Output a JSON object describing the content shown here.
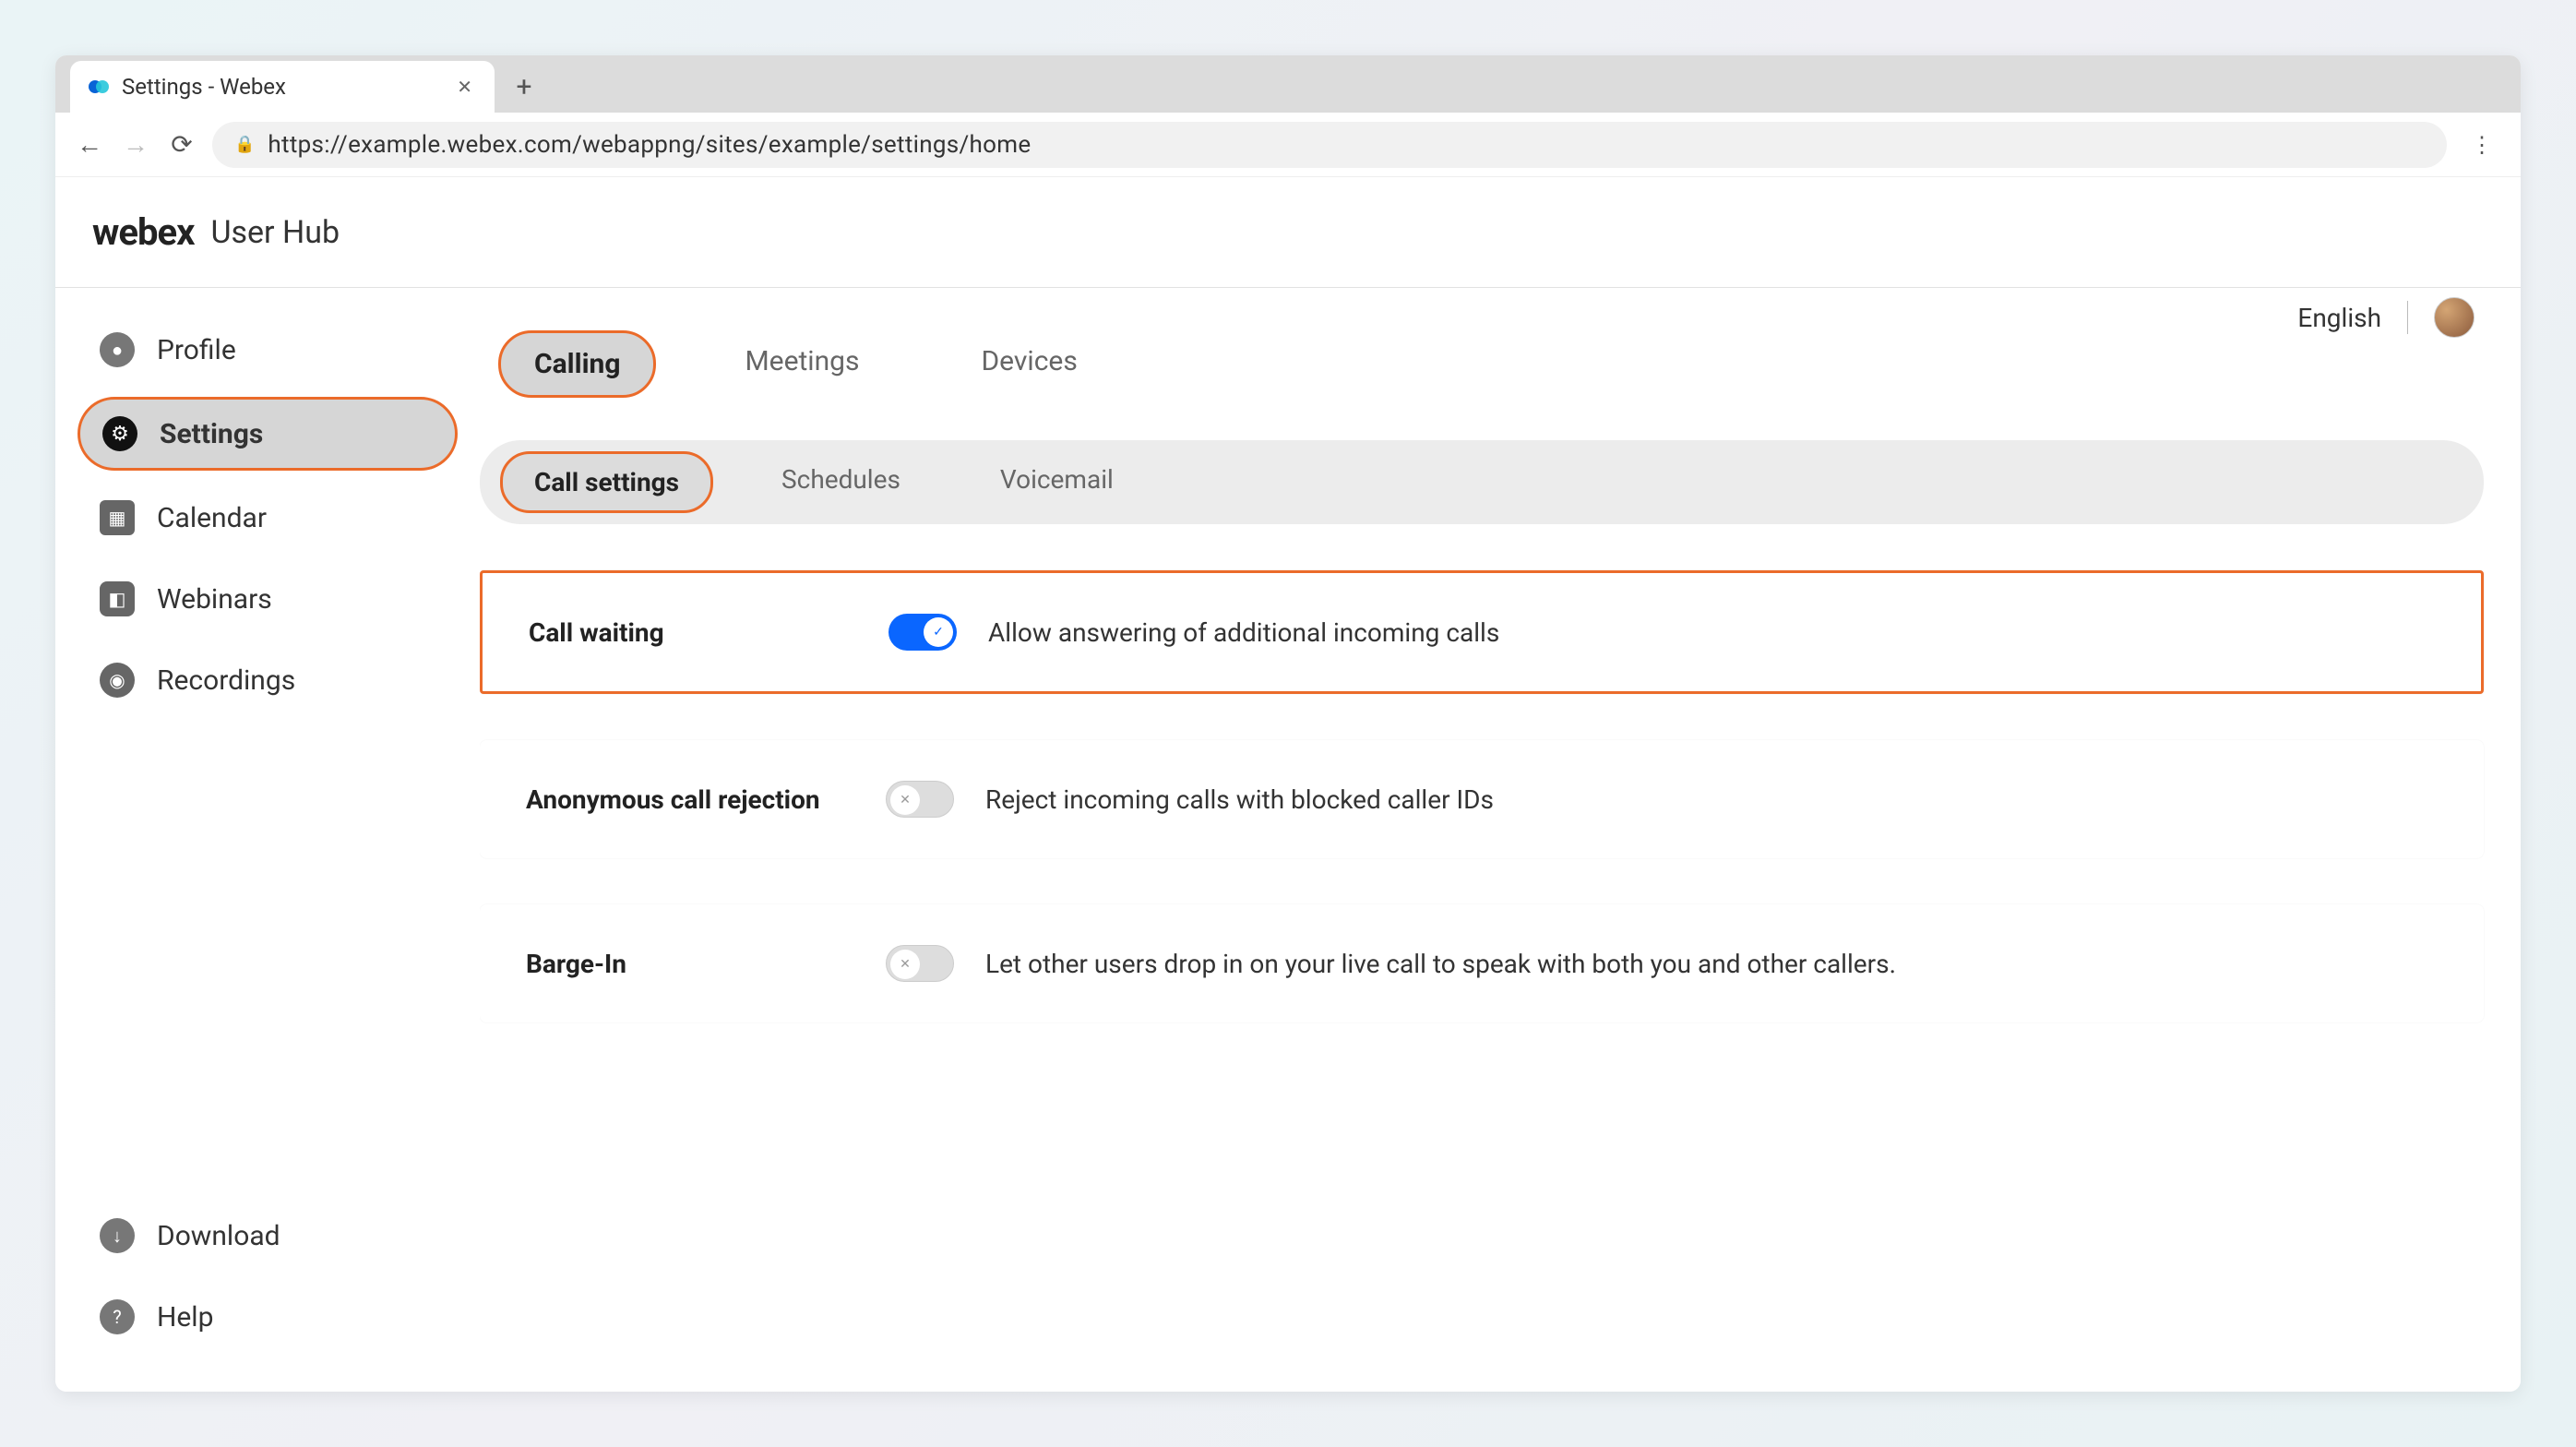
{
  "browser": {
    "tab_title": "Settings - Webex",
    "url": "https://example.webex.com/webappng/sites/example/settings/home"
  },
  "header": {
    "brand": "webex",
    "subtitle": "User Hub"
  },
  "topright": {
    "language": "English"
  },
  "sidebar": {
    "items": [
      {
        "label": "Profile"
      },
      {
        "label": "Settings"
      },
      {
        "label": "Calendar"
      },
      {
        "label": "Webinars"
      },
      {
        "label": "Recordings"
      }
    ],
    "bottom": [
      {
        "label": "Download"
      },
      {
        "label": "Help"
      }
    ]
  },
  "tabs": {
    "items": [
      {
        "label": "Calling"
      },
      {
        "label": "Meetings"
      },
      {
        "label": "Devices"
      }
    ]
  },
  "subtabs": {
    "items": [
      {
        "label": "Call settings"
      },
      {
        "label": "Schedules"
      },
      {
        "label": "Voicemail"
      }
    ]
  },
  "settings": {
    "call_waiting": {
      "title": "Call waiting",
      "desc": "Allow answering of additional incoming calls",
      "on": true
    },
    "anon_reject": {
      "title": "Anonymous call rejection",
      "desc": "Reject incoming calls with blocked caller IDs",
      "on": false
    },
    "barge_in": {
      "title": "Barge-In",
      "desc": "Let other users drop in on your live call to speak with both you and other callers.",
      "on": false
    }
  }
}
